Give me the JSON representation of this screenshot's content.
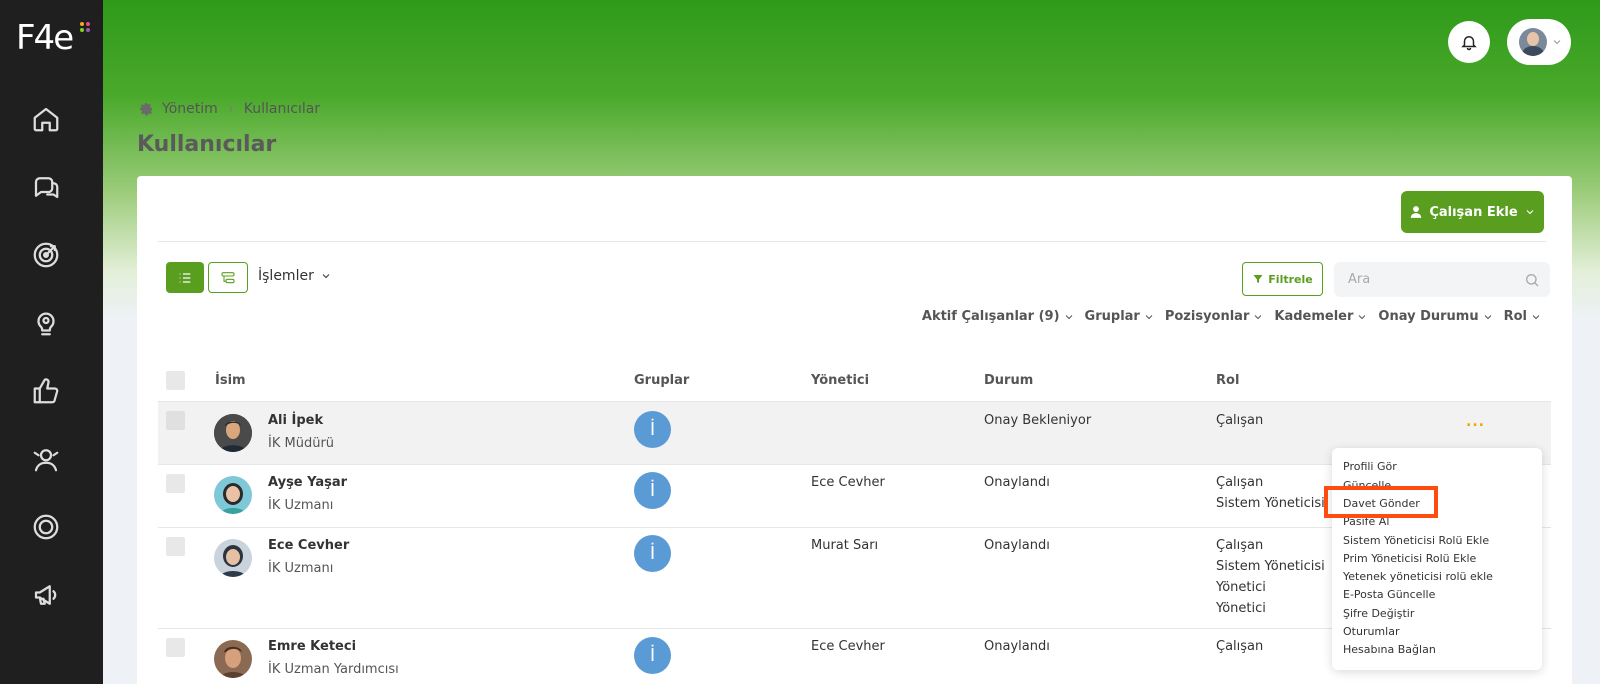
{
  "app": {
    "logo_text": "F4e"
  },
  "sidebar": {
    "items": [
      {
        "icon": "home-icon"
      },
      {
        "icon": "chat-icon"
      },
      {
        "icon": "target-icon"
      },
      {
        "icon": "lightbulb-icon"
      },
      {
        "icon": "thumbs-up-icon"
      },
      {
        "icon": "people-icon"
      },
      {
        "icon": "settings-icon"
      },
      {
        "icon": "megaphone-icon"
      }
    ]
  },
  "breadcrumb": {
    "root": "Yönetim",
    "current": "Kullanıcılar"
  },
  "page": {
    "title": "Kullanıcılar"
  },
  "toolbar": {
    "add_employee_label": "Çalışan Ekle",
    "actions_label": "İşlemler",
    "filter_label": "Filtrele",
    "search_placeholder": "Ara"
  },
  "filters": [
    "Aktif Çalışanlar (9)",
    "Gruplar",
    "Pozisyonlar",
    "Kademeler",
    "Onay Durumu",
    "Rol"
  ],
  "table": {
    "headers": {
      "name": "İsim",
      "groups": "Gruplar",
      "manager": "Yönetici",
      "status": "Durum",
      "role": "Rol"
    },
    "rows": [
      {
        "name": "Ali İpek",
        "title": "İK Müdürü",
        "group": "İ",
        "manager": "",
        "status": "Onay Bekleniyor",
        "roles": [
          "Çalışan"
        ]
      },
      {
        "name": "Ayşe Yaşar",
        "title": "İK Uzmanı",
        "group": "İ",
        "manager": "Ece Cevher",
        "status": "Onaylandı",
        "roles": [
          "Çalışan",
          "Sistem Yöneticisi"
        ]
      },
      {
        "name": "Ece Cevher",
        "title": "İK Uzmanı",
        "group": "İ",
        "manager": "Murat Sarı",
        "status": "Onaylandı",
        "roles": [
          "Çalışan",
          "Sistem Yöneticisi",
          "Yönetici",
          "Yönetici"
        ]
      },
      {
        "name": "Emre Keteci",
        "title": "İK Uzman Yardımcısı",
        "group": "İ",
        "manager": "Ece Cevher",
        "status": "Onaylandı",
        "roles": [
          "Çalışan"
        ]
      }
    ]
  },
  "row_menu": {
    "more_label": "...",
    "items": [
      "Profili Gör",
      "Güncelle",
      "Davet Gönder",
      "Pasife Al",
      "Sistem Yöneticisi Rolü Ekle",
      "Prim Yöneticisi Rolü Ekle",
      "Yetenek yöneticisi rolü ekle",
      "E-Posta Güncelle",
      "Şifre Değiştir",
      "Oturumlar",
      "Hesabına Bağlan"
    ],
    "highlighted_item": "Davet Gönder"
  },
  "colors": {
    "accent": "#5a9e1f",
    "group_badge": "#5b9bd5",
    "highlight": "#ff4d0f",
    "sidebar": "#1f1f1f"
  }
}
